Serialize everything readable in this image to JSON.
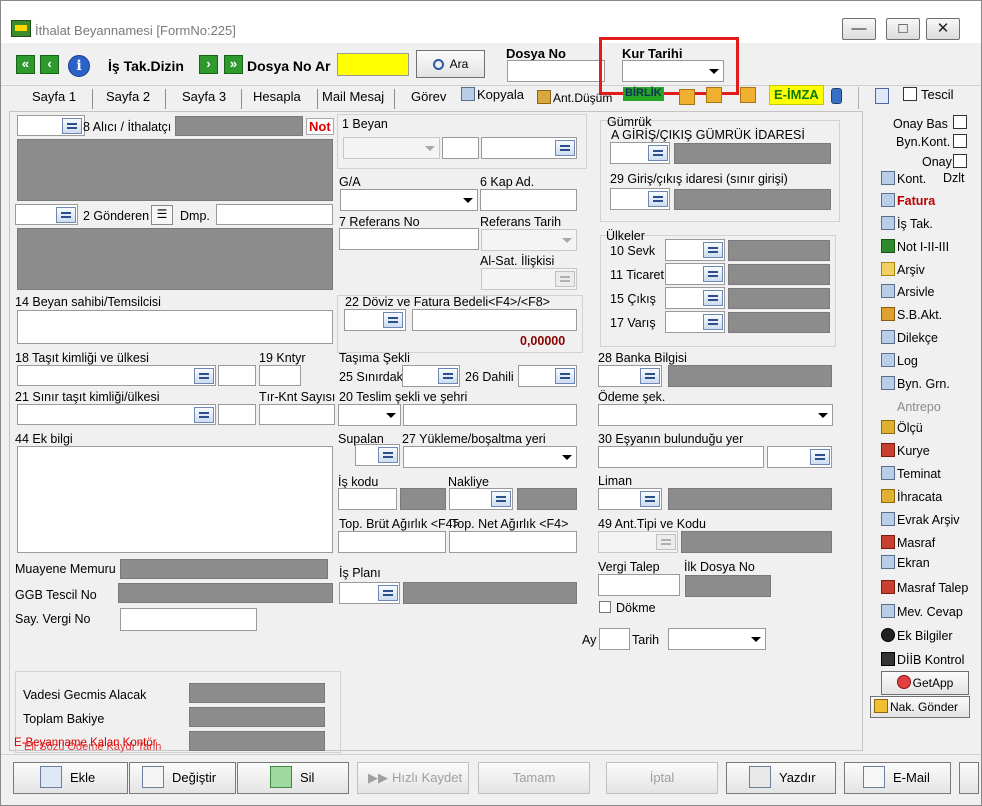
{
  "window": {
    "title": "İthalat Beyannamesi [FormNo:225]",
    "min": "—",
    "max": "□",
    "close": "✕"
  },
  "toolbar": {
    "is_tak_dizin": "İş Tak.Dizin",
    "dosya_no_ar": "Dosya No Ar",
    "ara": "Ara",
    "dosya_no_label": "Dosya No",
    "kur_tarihi_label": "Kur Tarihi"
  },
  "tabs": [
    "Sayfa 1",
    "Sayfa 2",
    "Sayfa 3",
    "Hesapla",
    "Mail Mesaj",
    "Görev"
  ],
  "toolbar2": {
    "kopyala": "Kopyala",
    "ant_dusum": "Ant.Düşüm",
    "birlik": "BİRLİK",
    "eimza": "E-İMZA",
    "tescil": "Tescil"
  },
  "left": {
    "alici": "8 Alıcı / İthalatçı",
    "not_label": "Not",
    "gonderen": "2 Gönderen",
    "dmp": "Dmp.",
    "beyan_sahibi": "14 Beyan sahibi/Temsilcisi",
    "tasit": "18 Taşıt kimliği ve ülkesi",
    "kntyr": "19 Kntyr",
    "sinir_tasit": "21 Sınır taşıt kimliği/ülkesi",
    "tir_knt": "Tır-Knt Sayısı",
    "ek_bilgi": "44 Ek bilgi",
    "muayene": "Muayene Memuru",
    "ggb": "GGB Tescil No",
    "say_vergi": "Say. Vergi No",
    "vadesi": "Vadesi Gecmis Alacak",
    "toplam_bakiye": "Toplam Bakiye",
    "ebeyan": "E-Beyanname Kalan Kontör",
    "el_sozu": "Eli Sözü Ödeme Kaydı Tarih"
  },
  "middle": {
    "beyan": "1 Beyan",
    "ga": "G/A",
    "kap_ad": "6 Kap Ad.",
    "referans_no": "7 Referans No",
    "referans_tarih": "Referans Tarih",
    "al_sat": "Al-Sat. İlişkisi",
    "doviz": "22 Döviz ve Fatura Bedeli<F4>/<F8>",
    "doviz_value": "0,00000",
    "tasima": "Taşıma Şekli",
    "sinirdaki": "25 Sınırdaki",
    "dahili": "26 Dahili",
    "teslim": "20 Teslim şekli ve şehri",
    "supalan": "Supalan",
    "yukleme": "27 Yükleme/boşaltma yeri",
    "is_kodu": "İş kodu",
    "nakliye": "Nakliye",
    "brut": "Top. Brüt Ağırlık <F4>",
    "net": "Top. Net Ağırlık <F4>",
    "is_plani": "İş Planı"
  },
  "right": {
    "gumruk": "Gümrük",
    "giris_cikis": "A GİRİŞ/ÇIKIŞ GÜMRÜK İDARESİ",
    "giris_29": "29 Giriş/çıkış idaresi (sınır girişi)",
    "ulkeler": "Ülkeler",
    "sevk": "10 Sevk",
    "ticaret": "11 Ticaret",
    "cikis": "15 Çıkış",
    "varis": "17 Varış",
    "banka": "28 Banka Bilgisi",
    "odeme": "Ödeme şek.",
    "esya": "30 Eşyanın bulunduğu yer",
    "liman": "Liman",
    "ant_tipi": "49 Ant.Tipi ve Kodu",
    "vergi_talep": "Vergi Talep",
    "ilk_dosya": "İlk Dosya No",
    "dokme": "Dökme",
    "ay": "Ay",
    "tarih": "Tarih"
  },
  "sidebar": {
    "onay_bas": "Onay Bas",
    "byn_kont": "Byn.Kont.",
    "onay": "Onay",
    "kont": "Kont.",
    "dzlt": "Dzlt",
    "items": [
      "Fatura",
      "İş Tak.",
      "Not I-II-III",
      "Arşiv",
      "Arsivle",
      "S.B.Akt.",
      "Dilekçe",
      "Log",
      "Byn. Grn.",
      "Antrepo",
      "Ölçü",
      "Kurye",
      "Teminat",
      "İhracata",
      "Evrak Arşiv",
      "Masraf",
      "Ekran",
      "Masraf Talep",
      "Mev. Cevap",
      "Ek Bilgiler",
      "DİİB Kontrol",
      "GetApp",
      "Nak. Gönder"
    ]
  },
  "bottom": {
    "ekle": "Ekle",
    "degistir": "Değiştir",
    "sil": "Sil",
    "hizli": "Hızlı Kaydet",
    "tamam": "Tamam",
    "iptal": "İptal",
    "yazdir": "Yazdır",
    "email": "E-Mail"
  }
}
